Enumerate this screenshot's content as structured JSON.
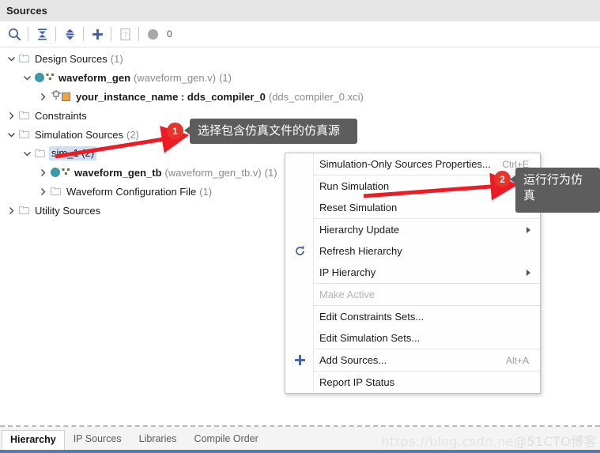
{
  "panel": {
    "title": "Sources"
  },
  "toolbar": {
    "buttons": [
      {
        "name": "search-icon",
        "label": "Search"
      },
      {
        "name": "collapse-all-icon",
        "label": "Collapse All"
      },
      {
        "name": "expand-all-icon",
        "label": "Expand All"
      },
      {
        "name": "add-sources-icon",
        "label": "Add Sources"
      },
      {
        "name": "help-icon",
        "label": "Help"
      }
    ],
    "status_count": "0"
  },
  "tree": [
    {
      "id": "design-sources",
      "label": "Design Sources",
      "count": "(1)",
      "indent": 0,
      "expanded": true,
      "icon": "folder",
      "bold": false,
      "selected": false
    },
    {
      "id": "waveform-gen",
      "label": "waveform_gen",
      "file": "(waveform_gen.v)",
      "count": "(1)",
      "indent": 1,
      "expanded": true,
      "icon": "module",
      "bold": true,
      "selected": false
    },
    {
      "id": "your-instance-name",
      "label": "your_instance_name : dds_compiler_0",
      "file": "(dds_compiler_0.xci)",
      "count": "",
      "indent": 2,
      "expanded": false,
      "icon": "ip",
      "bold": true,
      "selected": false
    },
    {
      "id": "constraints",
      "label": "Constraints",
      "count": "",
      "indent": 0,
      "expanded": false,
      "icon": "folder",
      "bold": false,
      "selected": false
    },
    {
      "id": "simulation-sources",
      "label": "Simulation Sources",
      "count": "(2)",
      "indent": 0,
      "expanded": true,
      "icon": "folder",
      "bold": false,
      "selected": false
    },
    {
      "id": "sim-1",
      "label": "sim_1 (2)",
      "count": "",
      "indent": 1,
      "expanded": true,
      "icon": "folder",
      "bold": false,
      "selected": true
    },
    {
      "id": "waveform-gen-tb",
      "label": "waveform_gen_tb",
      "file": "(waveform_gen_tb.v)",
      "count": "(1)",
      "indent": 2,
      "expanded": false,
      "icon": "module",
      "bold": true,
      "selected": false
    },
    {
      "id": "waveform-configuration-file",
      "label": "Waveform Configuration File",
      "file": "",
      "count": "(1)",
      "indent": 2,
      "expanded": false,
      "icon": "folder",
      "bold": false,
      "selected": false
    },
    {
      "id": "utility-sources",
      "label": "Utility Sources",
      "count": "",
      "indent": 0,
      "expanded": false,
      "icon": "folder",
      "bold": false,
      "selected": false
    }
  ],
  "context_menu": {
    "items": [
      {
        "id": "simulation-only-sources-properties",
        "label": "Simulation-Only Sources Properties...",
        "accel": "Ctrl+E",
        "submenu": false,
        "disabled": false,
        "icon": "",
        "sep_after": true
      },
      {
        "id": "run-simulation",
        "label": "Run Simulation",
        "accel": "",
        "submenu": true,
        "disabled": false,
        "icon": "",
        "sep_after": false
      },
      {
        "id": "reset-simulation",
        "label": "Reset Simulation",
        "accel": "",
        "submenu": true,
        "disabled": false,
        "icon": "",
        "sep_after": true
      },
      {
        "id": "hierarchy-update",
        "label": "Hierarchy Update",
        "accel": "",
        "submenu": true,
        "disabled": false,
        "icon": "",
        "sep_after": false
      },
      {
        "id": "refresh-hierarchy",
        "label": "Refresh Hierarchy",
        "accel": "",
        "submenu": false,
        "disabled": false,
        "icon": "refresh-icon",
        "sep_after": false
      },
      {
        "id": "ip-hierarchy",
        "label": "IP Hierarchy",
        "accel": "",
        "submenu": true,
        "disabled": false,
        "icon": "",
        "sep_after": true
      },
      {
        "id": "make-active",
        "label": "Make Active",
        "accel": "",
        "submenu": false,
        "disabled": true,
        "icon": "",
        "sep_after": true
      },
      {
        "id": "edit-constraints-sets",
        "label": "Edit Constraints Sets...",
        "accel": "",
        "submenu": false,
        "disabled": false,
        "icon": "",
        "sep_after": false
      },
      {
        "id": "edit-simulation-sets",
        "label": "Edit Simulation Sets...",
        "accel": "",
        "submenu": false,
        "disabled": false,
        "icon": "",
        "sep_after": true
      },
      {
        "id": "add-sources",
        "label": "Add Sources...",
        "accel": "Alt+A",
        "submenu": false,
        "disabled": false,
        "icon": "plus-icon",
        "sep_after": true
      },
      {
        "id": "report-ip-status",
        "label": "Report IP Status",
        "accel": "",
        "submenu": false,
        "disabled": false,
        "icon": "",
        "sep_after": false
      }
    ]
  },
  "annotations": [
    {
      "id": "callout-1",
      "number": "1",
      "text": "选择包含仿真文件的仿真源"
    },
    {
      "id": "callout-2",
      "number": "2",
      "text": "运行行为仿真"
    }
  ],
  "bottom_tabs": [
    {
      "id": "hierarchy",
      "label": "Hierarchy",
      "active": true
    },
    {
      "id": "ip-sources",
      "label": "IP Sources",
      "active": false
    },
    {
      "id": "libraries",
      "label": "Libraries",
      "active": false
    },
    {
      "id": "compile-order",
      "label": "Compile Order",
      "active": false
    }
  ],
  "watermark": {
    "text_a": "https://blog.csdn.ne",
    "text_b": "@51CTO博客"
  },
  "colors": {
    "header_bg": "#e6e6e6",
    "accent": "#3f5fa0",
    "selection": "#cfe0f5",
    "annotation_red": "#e8332a",
    "callout_bg": "#5d5d5d",
    "module_teal": "#3a9ba4",
    "ip_orange": "#f2a33c",
    "bottom_accent": "#4a7ebb"
  }
}
